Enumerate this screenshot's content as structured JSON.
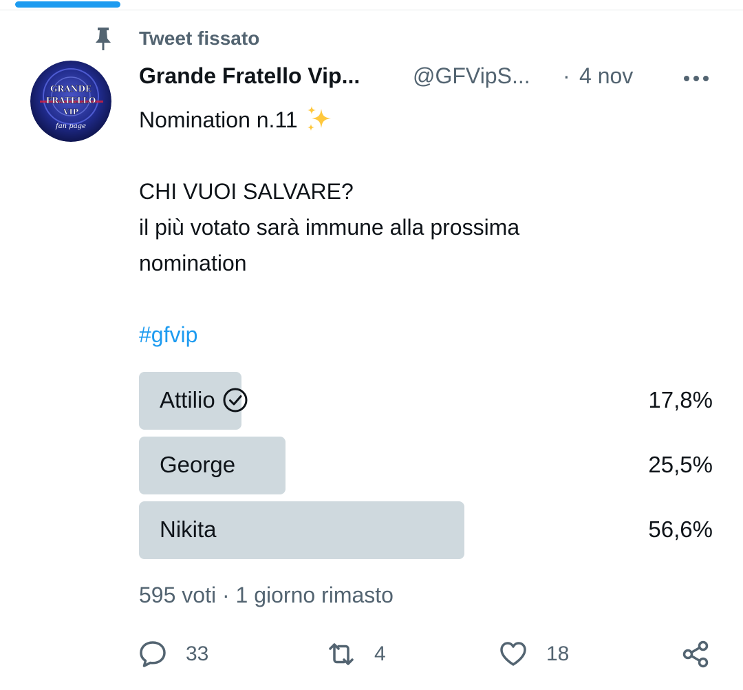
{
  "pinned": {
    "label": "Tweet fissato",
    "icon": "pin-icon"
  },
  "tweet": {
    "display_name": "Grande Fratello Vip...",
    "handle": "@GFVipS...",
    "separator": "·",
    "date": "4 nov",
    "avatar": {
      "line1": "GRANDE",
      "line2": "FRATELLO",
      "line3": "VIP",
      "caption": "fan page"
    },
    "text_line1": "Nomination n.11",
    "text_line2": "CHI VUOI SALVARE?",
    "text_line3": "il più votato sarà immune alla prossima",
    "text_line4": "nomination",
    "hashtag": "#gfvip"
  },
  "poll": {
    "options": [
      {
        "label": "Attilio",
        "percent_text": "17,8%",
        "percent": 17.8,
        "selected": true
      },
      {
        "label": "George",
        "percent_text": "25,5%",
        "percent": 25.5,
        "selected": false
      },
      {
        "label": "Nikita",
        "percent_text": "56,6%",
        "percent": 56.6,
        "selected": false
      }
    ],
    "votes": "595 voti",
    "separator": "·",
    "time_left": "1 giorno rimasto"
  },
  "actions": {
    "reply_count": "33",
    "retweet_count": "4",
    "like_count": "18"
  },
  "colors": {
    "accent": "#1d9bf0",
    "muted_text": "#536471",
    "poll_bar": "#cfd9de",
    "sparkle": "#ffc83d"
  }
}
